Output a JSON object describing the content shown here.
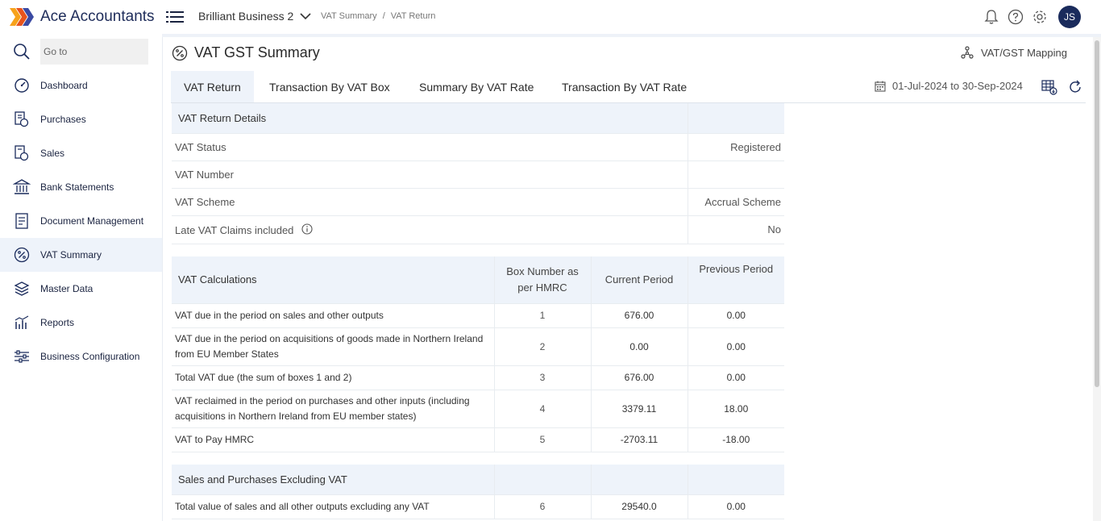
{
  "app": {
    "title": "Ace Accountants",
    "user_initials": "JS"
  },
  "header": {
    "business": "Brilliant Business 2",
    "breadcrumbs": [
      "VAT Summary",
      "VAT Return"
    ],
    "breadcrumb_sep": "/"
  },
  "sidebar": {
    "search_placeholder": "Go to",
    "items": [
      {
        "label": "Dashboard",
        "icon": "gauge-icon"
      },
      {
        "label": "Purchases",
        "icon": "purchases-icon"
      },
      {
        "label": "Sales",
        "icon": "sales-icon"
      },
      {
        "label": "Bank Statements",
        "icon": "bank-icon"
      },
      {
        "label": "Document Management",
        "icon": "document-icon"
      },
      {
        "label": "VAT Summary",
        "icon": "percent-icon",
        "active": true
      },
      {
        "label": "Master Data",
        "icon": "database-icon"
      },
      {
        "label": "Reports",
        "icon": "chart-icon"
      },
      {
        "label": "Business Configuration",
        "icon": "sliders-icon"
      }
    ]
  },
  "page": {
    "title": "VAT GST Summary",
    "mapping_label": "VAT/GST Mapping",
    "tabs": [
      "VAT Return",
      "Transaction By VAT Box",
      "Summary By VAT Rate",
      "Transaction By VAT Rate"
    ],
    "active_tab": "VAT Return",
    "period": "01-Jul-2024 to 30-Sep-2024"
  },
  "details": {
    "header": "VAT Return Details",
    "rows": [
      {
        "label": "VAT Status",
        "value": "Registered"
      },
      {
        "label": "VAT Number",
        "value": ""
      },
      {
        "label": "VAT Scheme",
        "value": "Accrual Scheme"
      },
      {
        "label": "Late VAT Claims included",
        "value": "No"
      }
    ]
  },
  "calc": {
    "header": "VAT Calculations",
    "col_box": "Box Number as per HMRC",
    "col_current": "Current Period",
    "col_previous": "Previous Period",
    "rows": [
      {
        "desc": "VAT due in the period on sales and other outputs",
        "box": "1",
        "current": "676.00",
        "previous": "0.00"
      },
      {
        "desc": "VAT due in the period on acquisitions of goods made in Northern Ireland from EU Member States",
        "box": "2",
        "current": "0.00",
        "previous": "0.00"
      },
      {
        "desc": "Total VAT due (the sum of boxes 1 and 2)",
        "box": "3",
        "current": "676.00",
        "previous": "0.00"
      },
      {
        "desc": "VAT reclaimed in the period on purchases and other inputs (including acquisitions in Northern Ireland from EU member states)",
        "box": "4",
        "current": "3379.11",
        "previous": "18.00"
      },
      {
        "desc": "VAT to Pay HMRC",
        "box": "5",
        "current": "-2703.11",
        "previous": "-18.00"
      }
    ]
  },
  "sales": {
    "header": "Sales and Purchases Excluding VAT",
    "rows": [
      {
        "desc": "Total value of sales and all other outputs excluding any VAT",
        "box": "6",
        "current": "29540.0",
        "previous": "0.00"
      }
    ]
  },
  "colors": {
    "accent": "#1a2b5c",
    "active_bg": "#eef3fa"
  }
}
